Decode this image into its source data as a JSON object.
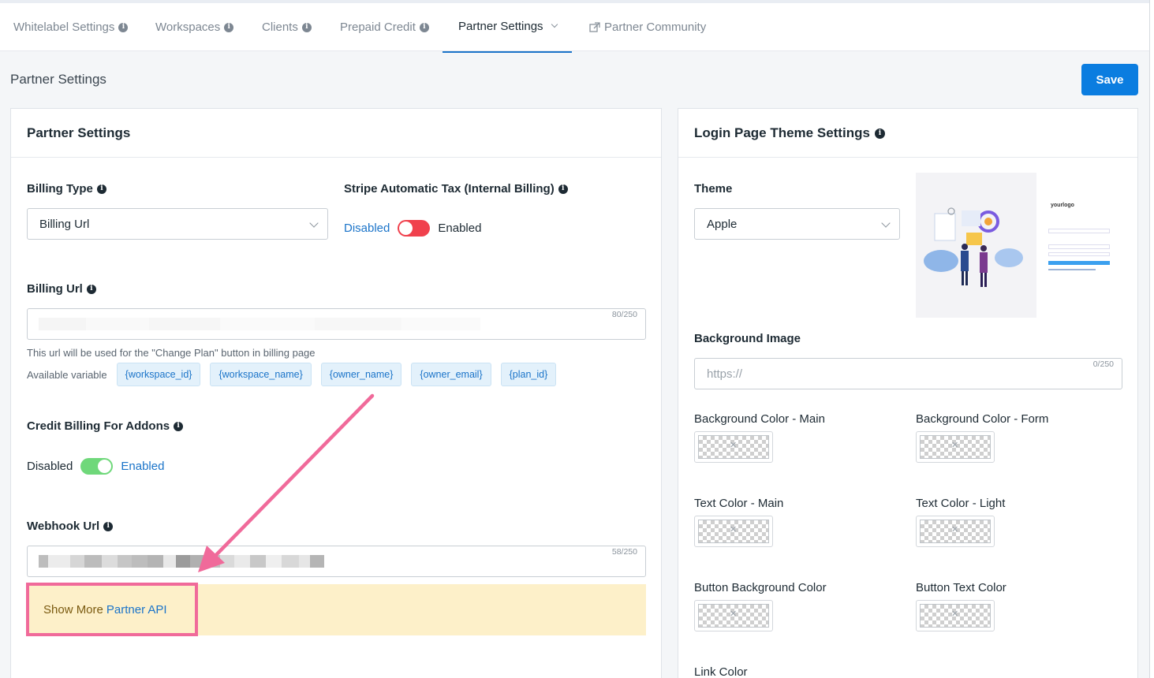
{
  "nav": {
    "tabs": [
      {
        "label": "Whitelabel Settings"
      },
      {
        "label": "Workspaces"
      },
      {
        "label": "Clients"
      },
      {
        "label": "Prepaid Credit"
      },
      {
        "label": "Partner Settings"
      },
      {
        "label": "Partner Community"
      }
    ]
  },
  "page": {
    "title": "Partner Settings",
    "save_label": "Save"
  },
  "partner_card": {
    "title": "Partner Settings",
    "billing_type": {
      "label": "Billing Type",
      "value": "Billing Url"
    },
    "stripe_tax": {
      "label": "Stripe Automatic Tax (Internal Billing)",
      "off_label": "Disabled",
      "on_label": "Enabled",
      "enabled": false
    },
    "billing_url": {
      "label": "Billing Url",
      "counter": "80/250",
      "help": "This url will be used for the \"Change Plan\" button in billing page",
      "variables_label": "Available variable",
      "variables": [
        "{workspace_id}",
        "{workspace_name}",
        "{owner_name}",
        "{owner_email}",
        "{plan_id}"
      ]
    },
    "credit_billing": {
      "label": "Credit Billing For Addons",
      "off_label": "Disabled",
      "on_label": "Enabled",
      "enabled": true
    },
    "webhook_url": {
      "label": "Webhook Url",
      "counter": "58/250"
    },
    "show_more": {
      "prefix": "Show More",
      "link": "Partner API"
    }
  },
  "theme_card": {
    "title": "Login Page Theme Settings",
    "theme": {
      "label": "Theme",
      "value": "Apple"
    },
    "background_image": {
      "label": "Background Image",
      "placeholder": "https://",
      "counter": "0/250"
    },
    "colors": [
      {
        "label": "Background Color - Main"
      },
      {
        "label": "Background Color - Form"
      },
      {
        "label": "Text Color - Main"
      },
      {
        "label": "Text Color - Light"
      },
      {
        "label": "Button Background Color"
      },
      {
        "label": "Button Text Color"
      },
      {
        "label": "Link Color"
      }
    ],
    "preview_logo": "yourlogo"
  },
  "colors": {
    "accent": "#1b74c9",
    "save": "#0b7de0",
    "toggle_off": "#f0414d",
    "toggle_on": "#6fd87a",
    "highlight": "#f06a9a",
    "notice": "#fdf0c9"
  }
}
